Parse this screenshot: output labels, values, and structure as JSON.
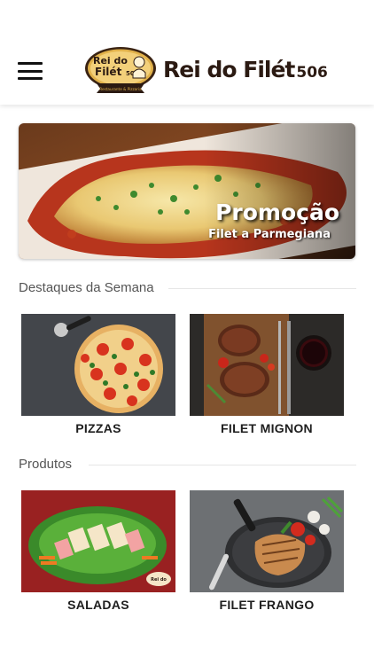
{
  "header": {
    "logo_line1": "Rei do",
    "logo_line2": "Filét",
    "logo_num": "506",
    "logo_ribbon": "Restaurante & Pizzaria",
    "brand_name": "Rei do Filét",
    "brand_number": "506"
  },
  "banner": {
    "title": "Promoção",
    "subtitle": "Filet a Parmegiana"
  },
  "sections": {
    "highlights_title": "Destaques da Semana",
    "products_title": "Produtos"
  },
  "highlights": [
    {
      "label": "PIZZAS"
    },
    {
      "label": "FILET MIGNON"
    }
  ],
  "products": [
    {
      "label": "SALADAS"
    },
    {
      "label": "FILET FRANGO"
    }
  ],
  "colors": {
    "brand_dark": "#2b1a12",
    "logo_gold": "#e2b24b",
    "section_text": "#555555"
  }
}
